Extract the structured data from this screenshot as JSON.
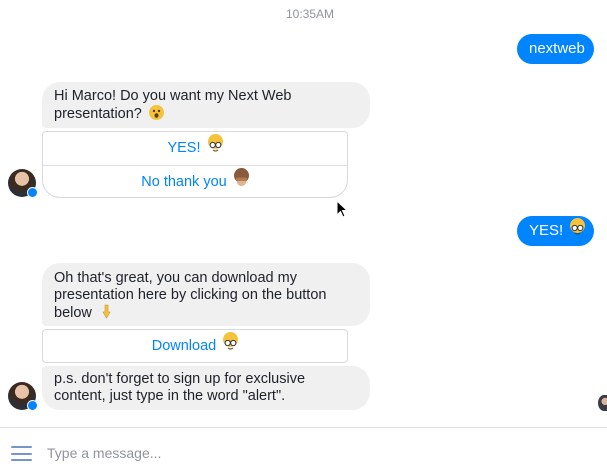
{
  "timestamp": "10:35AM",
  "colors": {
    "accent": "#0084ff",
    "incoming_bubble": "#f1f0f0",
    "text": "#1d2129",
    "muted": "#90949c"
  },
  "messages": {
    "out_1": "nextweb",
    "in_1": "Hi Marco! Do you want my Next Web presentation?",
    "in_1_emoji": "astonished-face-emoji",
    "quick_replies": [
      {
        "label": "YES!",
        "emoji": "nerd-face-emoji"
      },
      {
        "label": "No thank you",
        "emoji": "see-no-evil-monkey-emoji"
      }
    ],
    "out_2": "YES!",
    "out_2_emoji": "nerd-face-emoji",
    "in_2": "Oh that's great, you can download my presentation here by clicking on the button below",
    "in_2_emoji": "pointing-down-emoji",
    "download_button": {
      "label": "Download",
      "emoji": "nerd-face-emoji"
    },
    "in_3": "p.s. don't forget to sign up for exclusive content, just type in the word \"alert\"."
  },
  "composer": {
    "placeholder": "Type a message...",
    "value": ""
  }
}
